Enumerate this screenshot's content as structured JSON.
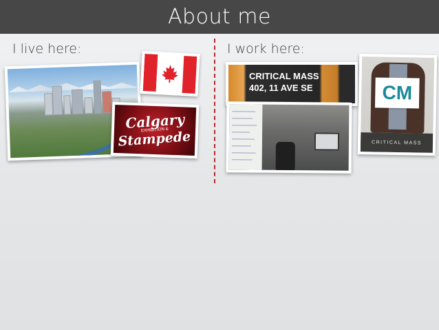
{
  "slide": {
    "title": "About me",
    "left_heading": "I live here:",
    "right_heading": "I work here:"
  },
  "photos": {
    "stampede_line1": "Calgary",
    "stampede_line2": "Stampede",
    "stampede_small": "EXHIBITION &",
    "office_sign_line1": "CRITICAL MASS",
    "office_sign_line2": "402, 11 AVE SE",
    "cm_logo": "CM",
    "cm_caption": "CRITICAL MASS"
  },
  "colors": {
    "title_bar": "#474747",
    "divider": "#b8242c",
    "canada_red": "#e0222a",
    "cm_teal": "#1b8a9a"
  }
}
